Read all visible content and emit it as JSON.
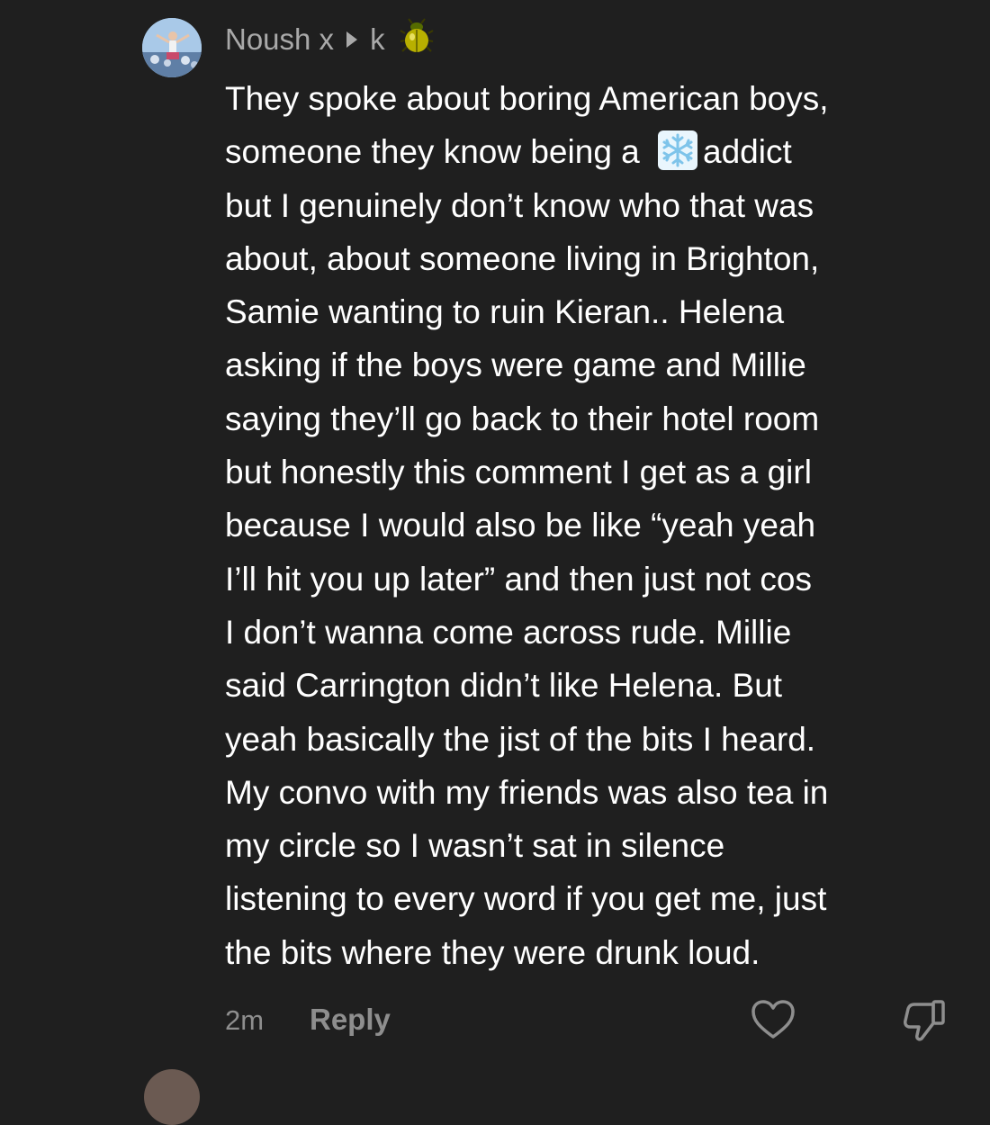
{
  "comment": {
    "author": "Noush x",
    "recipient": "k",
    "author_badge_icon": "beetle-icon",
    "body_lines": [
      [
        "They spoke about boring American boys,"
      ],
      [
        "someone they know being a ",
        "addict"
      ],
      [
        "but I genuinely don’t know who that was"
      ],
      [
        "about, about someone living in Brighton,"
      ],
      [
        "Samie wanting to ruin Kieran.. Helena"
      ],
      [
        "asking if the boys were game and Millie"
      ],
      [
        "saying they’ll go back to their hotel room"
      ],
      [
        "but honestly this comment I get as a girl"
      ],
      [
        "because I would also be like “yeah yeah"
      ],
      [
        "I’ll hit you up later” and then just not cos"
      ],
      [
        "I don’t wanna come across rude. Millie"
      ],
      [
        "said Carrington didn’t like Helena. But"
      ],
      [
        "yeah basically the jist of the bits I heard."
      ],
      [
        "My convo with my friends was also tea in"
      ],
      [
        "my circle so I wasn’t sat in silence"
      ],
      [
        "listening to every word if you get me, just"
      ],
      [
        "the bits where they were drunk loud."
      ]
    ],
    "inline_emoji": "snowflake-icon",
    "timestamp": "2m",
    "reply_label": "Reply",
    "like_icon": "heart-icon",
    "dislike_icon": "thumbs-down-icon"
  },
  "colors": {
    "background": "#1f1f1f",
    "text": "#ffffff",
    "muted": "#8e8e8e",
    "author": "#a9a9a9",
    "beetle": "#c8b400",
    "snowflake": "#9fd6f2"
  }
}
